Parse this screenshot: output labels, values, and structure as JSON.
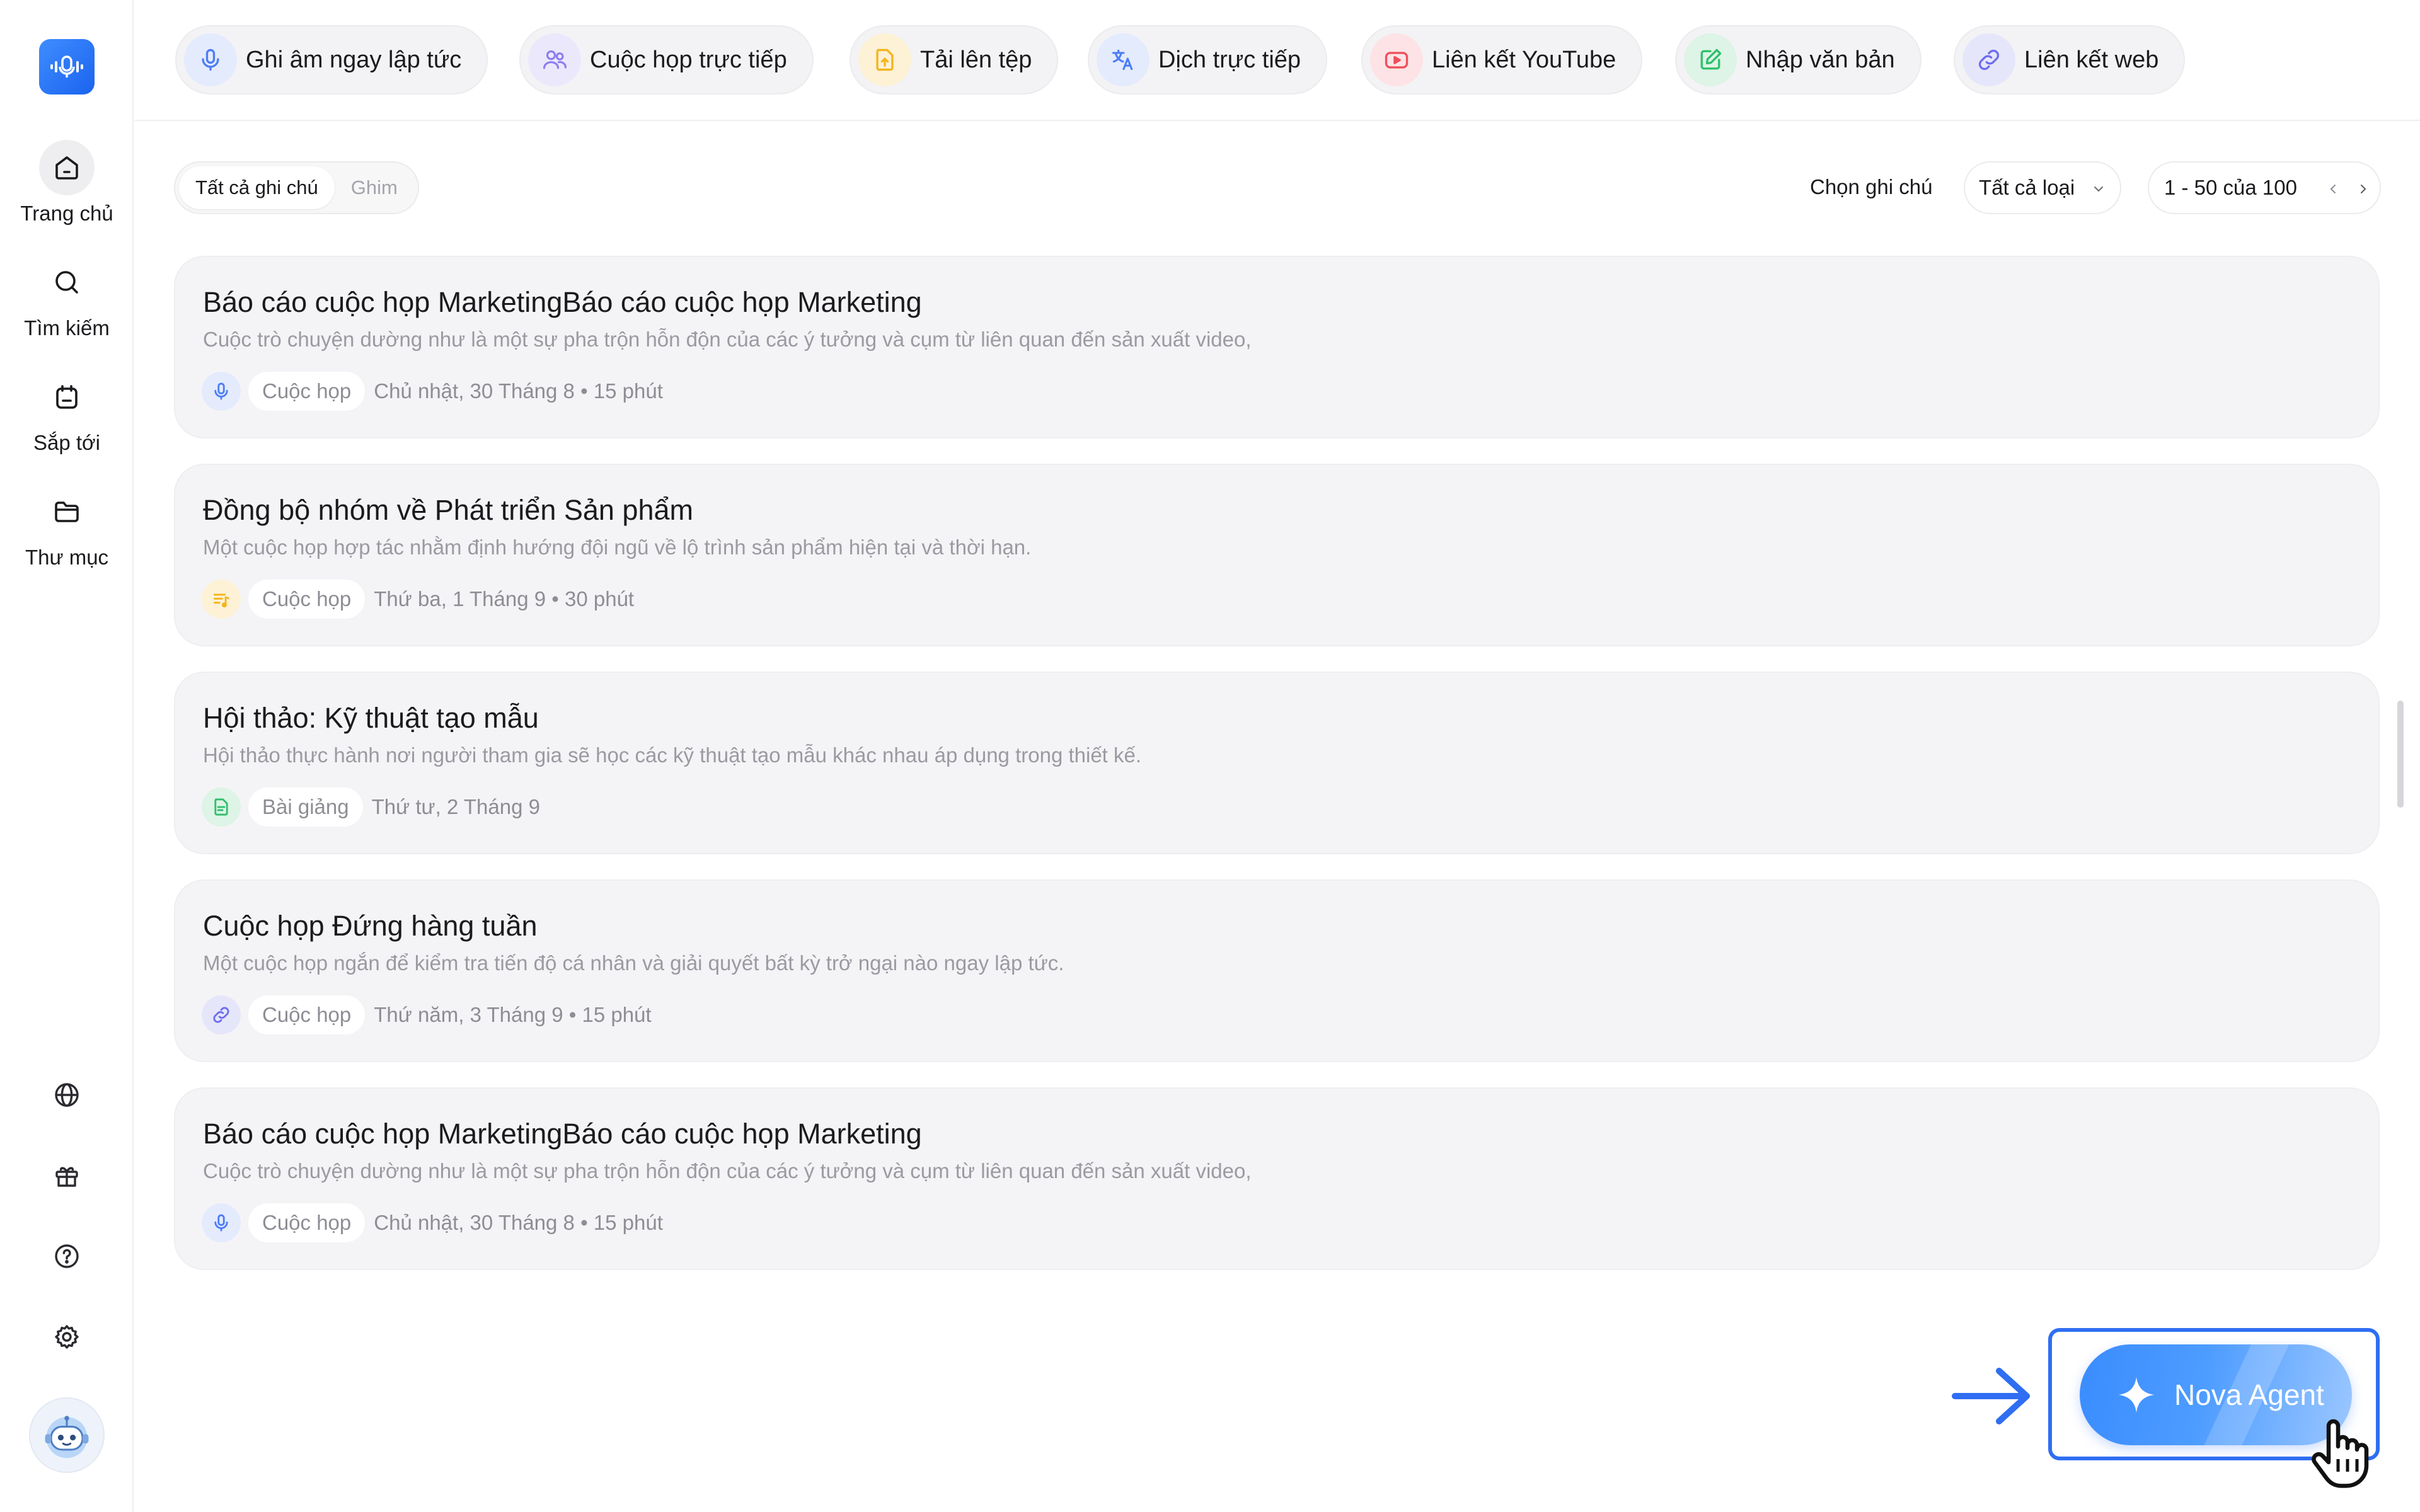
{
  "sidebar": {
    "items": [
      {
        "label": "Trang chủ",
        "icon": "home-icon",
        "active": true
      },
      {
        "label": "Tìm kiếm",
        "icon": "search-icon"
      },
      {
        "label": "Sắp tới",
        "icon": "calendar-icon"
      },
      {
        "label": "Thư mục",
        "icon": "folder-icon"
      }
    ],
    "tools": [
      "globe-icon",
      "gift-icon",
      "help-icon",
      "settings-icon"
    ],
    "avatar": "robot-avatar"
  },
  "toolbar": {
    "chips": [
      {
        "label": "Ghi âm ngay lập tức",
        "icon": "microphone-icon",
        "color": "#4d7df5"
      },
      {
        "label": "Cuộc họp trực tiếp",
        "icon": "people-icon",
        "color": "#8b7cf0"
      },
      {
        "label": "Tải lên tệp",
        "icon": "upload-file-icon",
        "color": "#f3b51b"
      },
      {
        "label": "Dịch trực tiếp",
        "icon": "translate-icon",
        "color": "#4d7df5"
      },
      {
        "label": "Liên kết YouTube",
        "icon": "youtube-icon",
        "color": "#ef4e5b"
      },
      {
        "label": "Nhập văn bản",
        "icon": "edit-text-icon",
        "color": "#2fbf6b"
      },
      {
        "label": "Liên kết web",
        "icon": "link-icon",
        "color": "#6d6df0"
      }
    ]
  },
  "filters": {
    "tab_all": "Tất cả ghi chú",
    "tab_pinned": "Ghim",
    "select_label": "Chọn ghi chú",
    "type_select": "Tất cả loại",
    "pagination": "1 - 50 của 100"
  },
  "notes": [
    {
      "title": "Báo cáo cuộc họp MarketingBáo cáo cuộc họp Marketing",
      "desc": "Cuộc trò chuyện dường như là một sự pha trộn hỗn độn của các ý tưởng và cụm từ liên quan đến sản xuất video,",
      "type": "Cuộc họp",
      "date": "Chủ nhật, 30 Tháng 8 • 15 phút",
      "icon": "microphone-icon",
      "icon_color": "#4d7df5",
      "icon_bg": "#e4ebfd"
    },
    {
      "title": "Đồng bộ nhóm về Phát triển Sản phẩm",
      "desc": "Một cuộc họp hợp tác nhằm định hướng đội ngũ về lộ trình sản phẩm hiện tại và thời hạn.",
      "type": "Cuộc họp",
      "date": "Thứ ba, 1 Tháng 9 • 30 phút",
      "icon": "text-note-icon",
      "icon_color": "#f3b51b",
      "icon_bg": "#fdf1d6"
    },
    {
      "title": "Hội thảo: Kỹ thuật tạo mẫu",
      "desc": "Hội thảo thực hành nơi người tham gia sẽ học các kỹ thuật tạo mẫu khác nhau áp dụng trong thiết kế.",
      "type": "Bài giảng",
      "date": "Thứ tư, 2 Tháng 9",
      "icon": "document-icon",
      "icon_color": "#2fbf6b",
      "icon_bg": "#ddf4e6"
    },
    {
      "title": "Cuộc họp Đứng hàng tuần",
      "desc": "Một cuộc họp ngắn để kiểm tra tiến độ cá nhân và giải quyết bất kỳ trở ngại nào ngay lập tức.",
      "type": "Cuộc họp",
      "date": "Thứ năm, 3 Tháng 9 • 15 phút",
      "icon": "link-icon",
      "icon_color": "#6d6df0",
      "icon_bg": "#e6e6fb"
    },
    {
      "title": "Báo cáo cuộc họp MarketingBáo cáo cuộc họp Marketing",
      "desc": "Cuộc trò chuyện dường như là một sự pha trộn hỗn độn của các ý tưởng và cụm từ liên quan đến sản xuất video,",
      "type": "Cuộc họp",
      "date": "Chủ nhật, 30 Tháng 8 • 15 phút",
      "icon": "microphone-icon",
      "icon_color": "#4d7df5",
      "icon_bg": "#e4ebfd"
    }
  ],
  "agent": {
    "label": "Nova Agent",
    "accent": "#2f6ef2"
  }
}
